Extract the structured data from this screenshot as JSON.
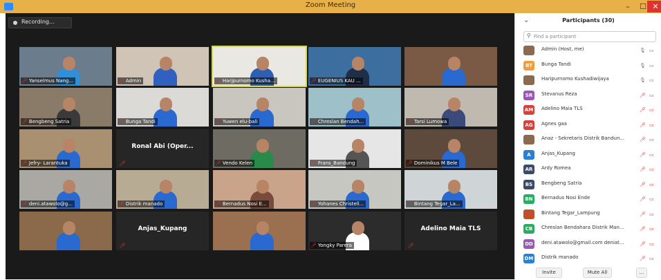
{
  "window": {
    "title": "Zoom Meeting",
    "min": "–",
    "max": "☐",
    "close": "✕"
  },
  "recording": {
    "label": "Recording..."
  },
  "tiles": [
    {
      "name": "Yanselmus Nang...",
      "kind": "video",
      "bg": "#6b7d8c",
      "shirt": "#2f8fd8",
      "col": 0,
      "row": 0
    },
    {
      "name": "Admin",
      "kind": "video",
      "bg": "#cfc4b5",
      "shirt": "#3060c0",
      "col": 1,
      "row": 0
    },
    {
      "name": "Harjpurnomo Kusha...",
      "kind": "video",
      "bg": "#e9e8e2",
      "shirt": "#2f5fb0",
      "col": 2,
      "row": 0,
      "active": true
    },
    {
      "name": "EUGENIUS KAU ...",
      "kind": "video",
      "bg": "#3c6fa0",
      "shirt": "#1f2f4a",
      "col": 3,
      "row": 0
    },
    {
      "name": "",
      "kind": "video",
      "bg": "#7a5a45",
      "shirt": "#2a6ad0",
      "col": 4,
      "row": 0
    },
    {
      "name": "Bengbeng Satria",
      "kind": "video",
      "bg": "#8a7a68",
      "shirt": "#3a3a3a",
      "col": 0,
      "row": 1
    },
    {
      "name": "Bunga Tandi",
      "kind": "video",
      "bg": "#dcdad6",
      "shirt": "#2a6ad0",
      "col": 1,
      "row": 1
    },
    {
      "name": "Yuwen elu-bali",
      "kind": "video",
      "bg": "#c9c6bf",
      "shirt": "#2a6ad0",
      "col": 2,
      "row": 1
    },
    {
      "name": "Chreslan Bendah...",
      "kind": "video",
      "bg": "#9ec0c8",
      "shirt": "#2a6ad0",
      "col": 3,
      "row": 1
    },
    {
      "name": "Tarsi Lumowa",
      "kind": "video",
      "bg": "#bfb9b0",
      "shirt": "#3a4a7a",
      "col": 4,
      "row": 1
    },
    {
      "name": "Jefry- Larantuka",
      "kind": "video",
      "bg": "#a89070",
      "shirt": "#2a6ad0",
      "col": 0,
      "row": 2
    },
    {
      "name": "Ronal Abi (Oper...",
      "kind": "name",
      "col": 1,
      "row": 2
    },
    {
      "name": "Vendo Kelen",
      "kind": "video",
      "bg": "#6e6c62",
      "shirt": "#2a8a4a",
      "col": 2,
      "row": 2
    },
    {
      "name": "Frans_Bandung",
      "kind": "video",
      "bg": "#e6e6e6",
      "shirt": "#555",
      "col": 3,
      "row": 2
    },
    {
      "name": "Dominikus M Bele",
      "kind": "video",
      "bg": "#5d4a3c",
      "shirt": "#2a6ad0",
      "col": 4,
      "row": 2
    },
    {
      "name": "deni.atawolo@g...",
      "kind": "video",
      "bg": "#a9a8a2",
      "shirt": "#2a6ad0",
      "col": 0,
      "row": 3
    },
    {
      "name": "Distrik manado",
      "kind": "video",
      "bg": "#b8ab94",
      "shirt": "#2a6ad0",
      "col": 1,
      "row": 3
    },
    {
      "name": "Bernadus Nosi E...",
      "kind": "video",
      "bg": "#caa48a",
      "shirt": "#7a4a3a",
      "col": 2,
      "row": 3
    },
    {
      "name": "Yohanes Christell...",
      "kind": "video",
      "bg": "#c7c7c2",
      "shirt": "#2a6ad0",
      "col": 3,
      "row": 3
    },
    {
      "name": "Bintang Tegar_La...",
      "kind": "video",
      "bg": "#cfd4d6",
      "shirt": "#2a6ad0",
      "col": 4,
      "row": 3
    },
    {
      "name": "",
      "kind": "video",
      "bg": "#8a6a4a",
      "shirt": "#2a6ad0",
      "col": 0,
      "row": 4
    },
    {
      "name": "Anjas_Kupang",
      "kind": "name",
      "col": 1,
      "row": 4
    },
    {
      "name": "",
      "kind": "video",
      "bg": "#9a7050",
      "shirt": "#2a6ad0",
      "col": 2,
      "row": 4
    },
    {
      "name": "Yongky Parera",
      "kind": "video",
      "bg": "#2c2c2c",
      "shirt": "#ffffff",
      "col": 3,
      "row": 4
    },
    {
      "name": "Adelino Maia TLS",
      "kind": "name",
      "col": 4,
      "row": 4
    }
  ],
  "participants": {
    "header": "Participants (30)",
    "search_placeholder": "Find a participant",
    "list": [
      {
        "name": "Admin (Host, me)",
        "initials": "",
        "color": "#8a6b52",
        "photo": true,
        "muted": false
      },
      {
        "name": "Bunga Tandi",
        "initials": "BT",
        "color": "#f39c3a",
        "photo": false,
        "muted": false
      },
      {
        "name": "Haripurnomo Kushadiwijaya",
        "initials": "",
        "color": "#8a6b52",
        "photo": true,
        "muted": false
      },
      {
        "name": "Stevanus Reza",
        "initials": "SR",
        "color": "#9b59b6",
        "photo": false,
        "muted": true
      },
      {
        "name": "Adelino Maia TLS",
        "initials": "AM",
        "color": "#d9403a",
        "photo": false,
        "muted": true
      },
      {
        "name": "Agnes gaa",
        "initials": "AG",
        "color": "#d9403a",
        "photo": false,
        "muted": true
      },
      {
        "name": "Anaz - Sekretaris Distrik Bandun...",
        "initials": "",
        "color": "#8a6b52",
        "photo": true,
        "muted": true
      },
      {
        "name": "Anjas_Kupang",
        "initials": "A",
        "color": "#2e7fd1",
        "photo": false,
        "muted": true
      },
      {
        "name": "Ardy Romea",
        "initials": "AR",
        "color": "#3a4a6a",
        "photo": false,
        "muted": true
      },
      {
        "name": "Bengbeng Satria",
        "initials": "BS",
        "color": "#3a4a6a",
        "photo": false,
        "muted": true
      },
      {
        "name": "Bernadus Nosi Ende",
        "initials": "BN",
        "color": "#27ae60",
        "photo": false,
        "muted": true
      },
      {
        "name": "Bintang Tegar_Lampung",
        "initials": "",
        "color": "#c0502a",
        "photo": true,
        "muted": true
      },
      {
        "name": "Chreslan Bendahara Distrik Man...",
        "initials": "CB",
        "color": "#27ae60",
        "photo": false,
        "muted": true
      },
      {
        "name": "deni.atawolo@gmail.com deniat...",
        "initials": "DD",
        "color": "#9b59b6",
        "photo": false,
        "muted": true
      },
      {
        "name": "Distrik manado",
        "initials": "DM",
        "color": "#2e7fd1",
        "photo": false,
        "muted": true
      }
    ],
    "invite": "Invite",
    "mute_all": "Mute All",
    "more": "..."
  }
}
